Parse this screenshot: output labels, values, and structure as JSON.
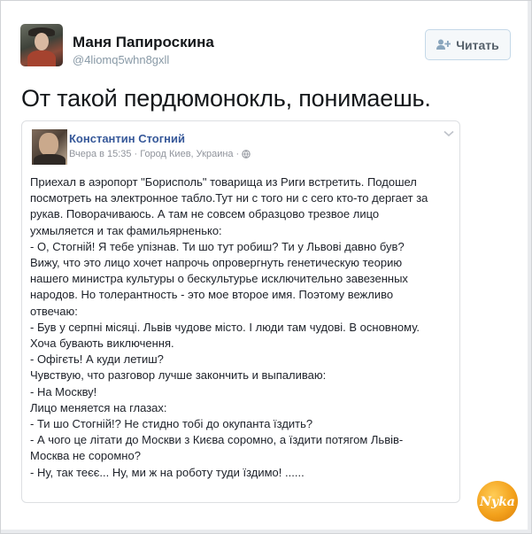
{
  "tweet": {
    "author_name": "Маня Папироскина",
    "author_handle": "@4liomq5whn8gxll",
    "follow_label": "Читать",
    "text": "От такой пердюмонокль, понимаешь."
  },
  "embedded_post": {
    "author": "Константин Стогний",
    "time": "Вчера в 15:35",
    "separator": "·",
    "location": "Город Киев, Украина",
    "separator2": "·",
    "body_lines": [
      "Приехал в аэропорт \"Борисполь\" товарища из Риги встретить. Подошел",
      "посмотреть на электронное табло.Тут ни с того ни с сего кто-то дергает за",
      "рукав. Поворачиваюсь. А там не совсем образцово трезвое лицо",
      "ухмыляется и так фамильярненько:",
      "- О, Стогнiй! Я тебе упiзнав. Ти шо тут робиш? Ти у Львовi давно був?",
      "Вижу, что это лицо хочет напрочь опровергнуть генетическую теорию",
      "нашего министра культуры о бескультурье исключительно завезенных",
      "народов. Но толерантность - это мое второе имя. Поэтому вежливо",
      "отвечаю:",
      "- Був у серпнi мiсяцi. Львiв чудове мiсто. I люди там чудовi. В основному.",
      "Хоча бувають виключення.",
      "- Офiгєть! А куди летиш?",
      "Чувствую, что разговор лучше закончить и выпаливаю:",
      "- На Москву!",
      "Лицо меняется на глазах:",
      "- Ти шо Стогнiй!? Не стидно тобi до окупанта їздить?",
      "- А чого це лiтати до Москви з Києва соромно, а їздити потягом Львiв-",
      "Москва не соромно?",
      "- Ну, так теєє... Ну, ми ж на роботу туди їздимо! ......"
    ]
  },
  "watermark": {
    "text": "Nyka",
    "color": "#f3a11c"
  }
}
